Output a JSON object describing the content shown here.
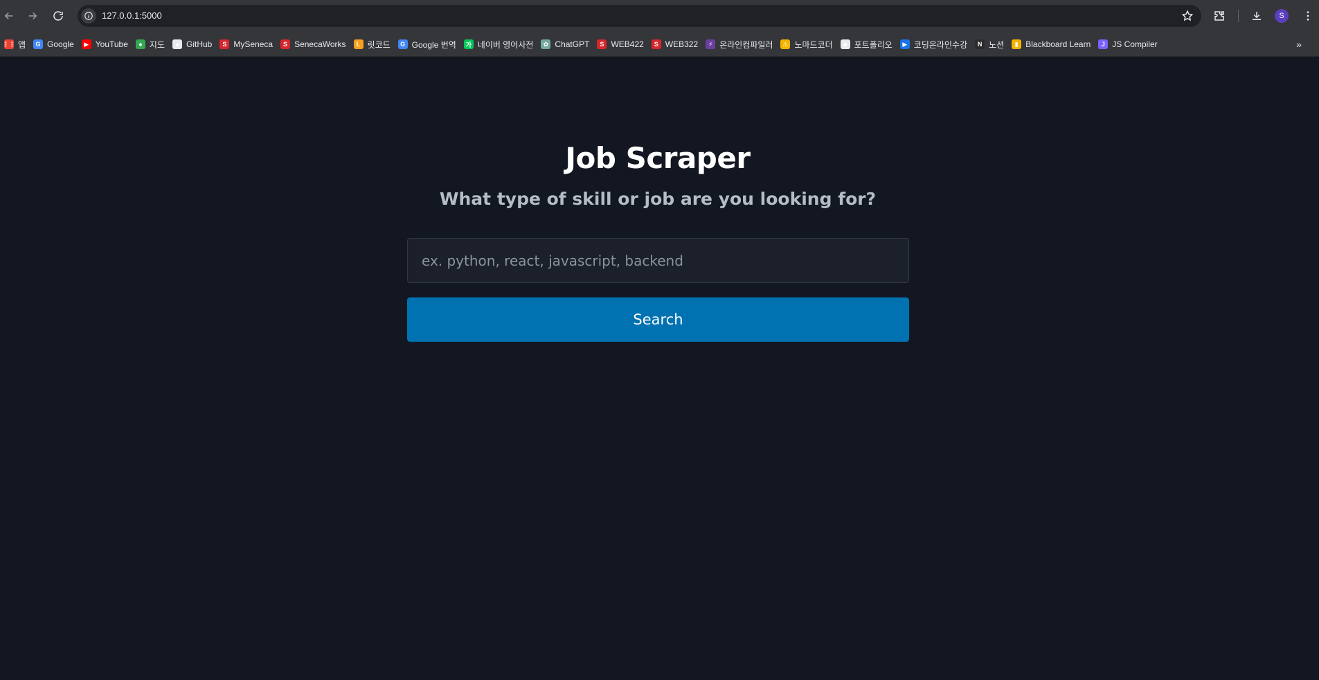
{
  "browser": {
    "url": "127.0.0.1:5000",
    "profile_initial": "S",
    "bookmarks": [
      {
        "label": "앱",
        "icon": "apps-grid-icon",
        "color": "#ea4335"
      },
      {
        "label": "Google",
        "icon": "google-icon",
        "color": "#4285f4"
      },
      {
        "label": "YouTube",
        "icon": "youtube-icon",
        "color": "#ff0000"
      },
      {
        "label": "지도",
        "icon": "maps-icon",
        "color": "#34a853"
      },
      {
        "label": "GitHub",
        "icon": "github-icon",
        "color": "#e8eaed"
      },
      {
        "label": "MySeneca",
        "icon": "seneca-icon",
        "color": "#d9262c"
      },
      {
        "label": "SenecaWorks",
        "icon": "seneca-icon",
        "color": "#d9262c"
      },
      {
        "label": "릿코드",
        "icon": "leetcode-icon",
        "color": "#f89f1b"
      },
      {
        "label": "Google 번역",
        "icon": "translate-icon",
        "color": "#4285f4"
      },
      {
        "label": "네이버 영어사전",
        "icon": "naver-icon",
        "color": "#03c75a"
      },
      {
        "label": "ChatGPT",
        "icon": "chatgpt-icon",
        "color": "#74aa9c"
      },
      {
        "label": "WEB422",
        "icon": "seneca-icon",
        "color": "#d9262c"
      },
      {
        "label": "WEB322",
        "icon": "seneca-icon",
        "color": "#d9262c"
      },
      {
        "label": "온라인컴파일러",
        "icon": "bolt-icon",
        "color": "#6b3fa0"
      },
      {
        "label": "노마드코더",
        "icon": "nomad-icon",
        "color": "#f4b400"
      },
      {
        "label": "포트폴리오",
        "icon": "portfolio-icon",
        "color": "#e8eaed"
      },
      {
        "label": "코딩온라인수강",
        "icon": "play-icon",
        "color": "#1a73e8"
      },
      {
        "label": "노션",
        "icon": "notion-icon",
        "color": "#2b2b2b"
      },
      {
        "label": "Blackboard Learn",
        "icon": "blackboard-icon",
        "color": "#f4b400"
      },
      {
        "label": "JS Compiler",
        "icon": "js-compiler-icon",
        "color": "#7b61ff"
      }
    ],
    "overflow_label": "»"
  },
  "page": {
    "title": "Job Scraper",
    "subtitle": "What type of skill or job are you looking for?",
    "search_placeholder": "ex. python, react, javascript, backend",
    "search_value": "",
    "search_button_label": "Search"
  },
  "colors": {
    "background": "#131722",
    "button": "#0172b1",
    "input_background": "#1c202b"
  }
}
